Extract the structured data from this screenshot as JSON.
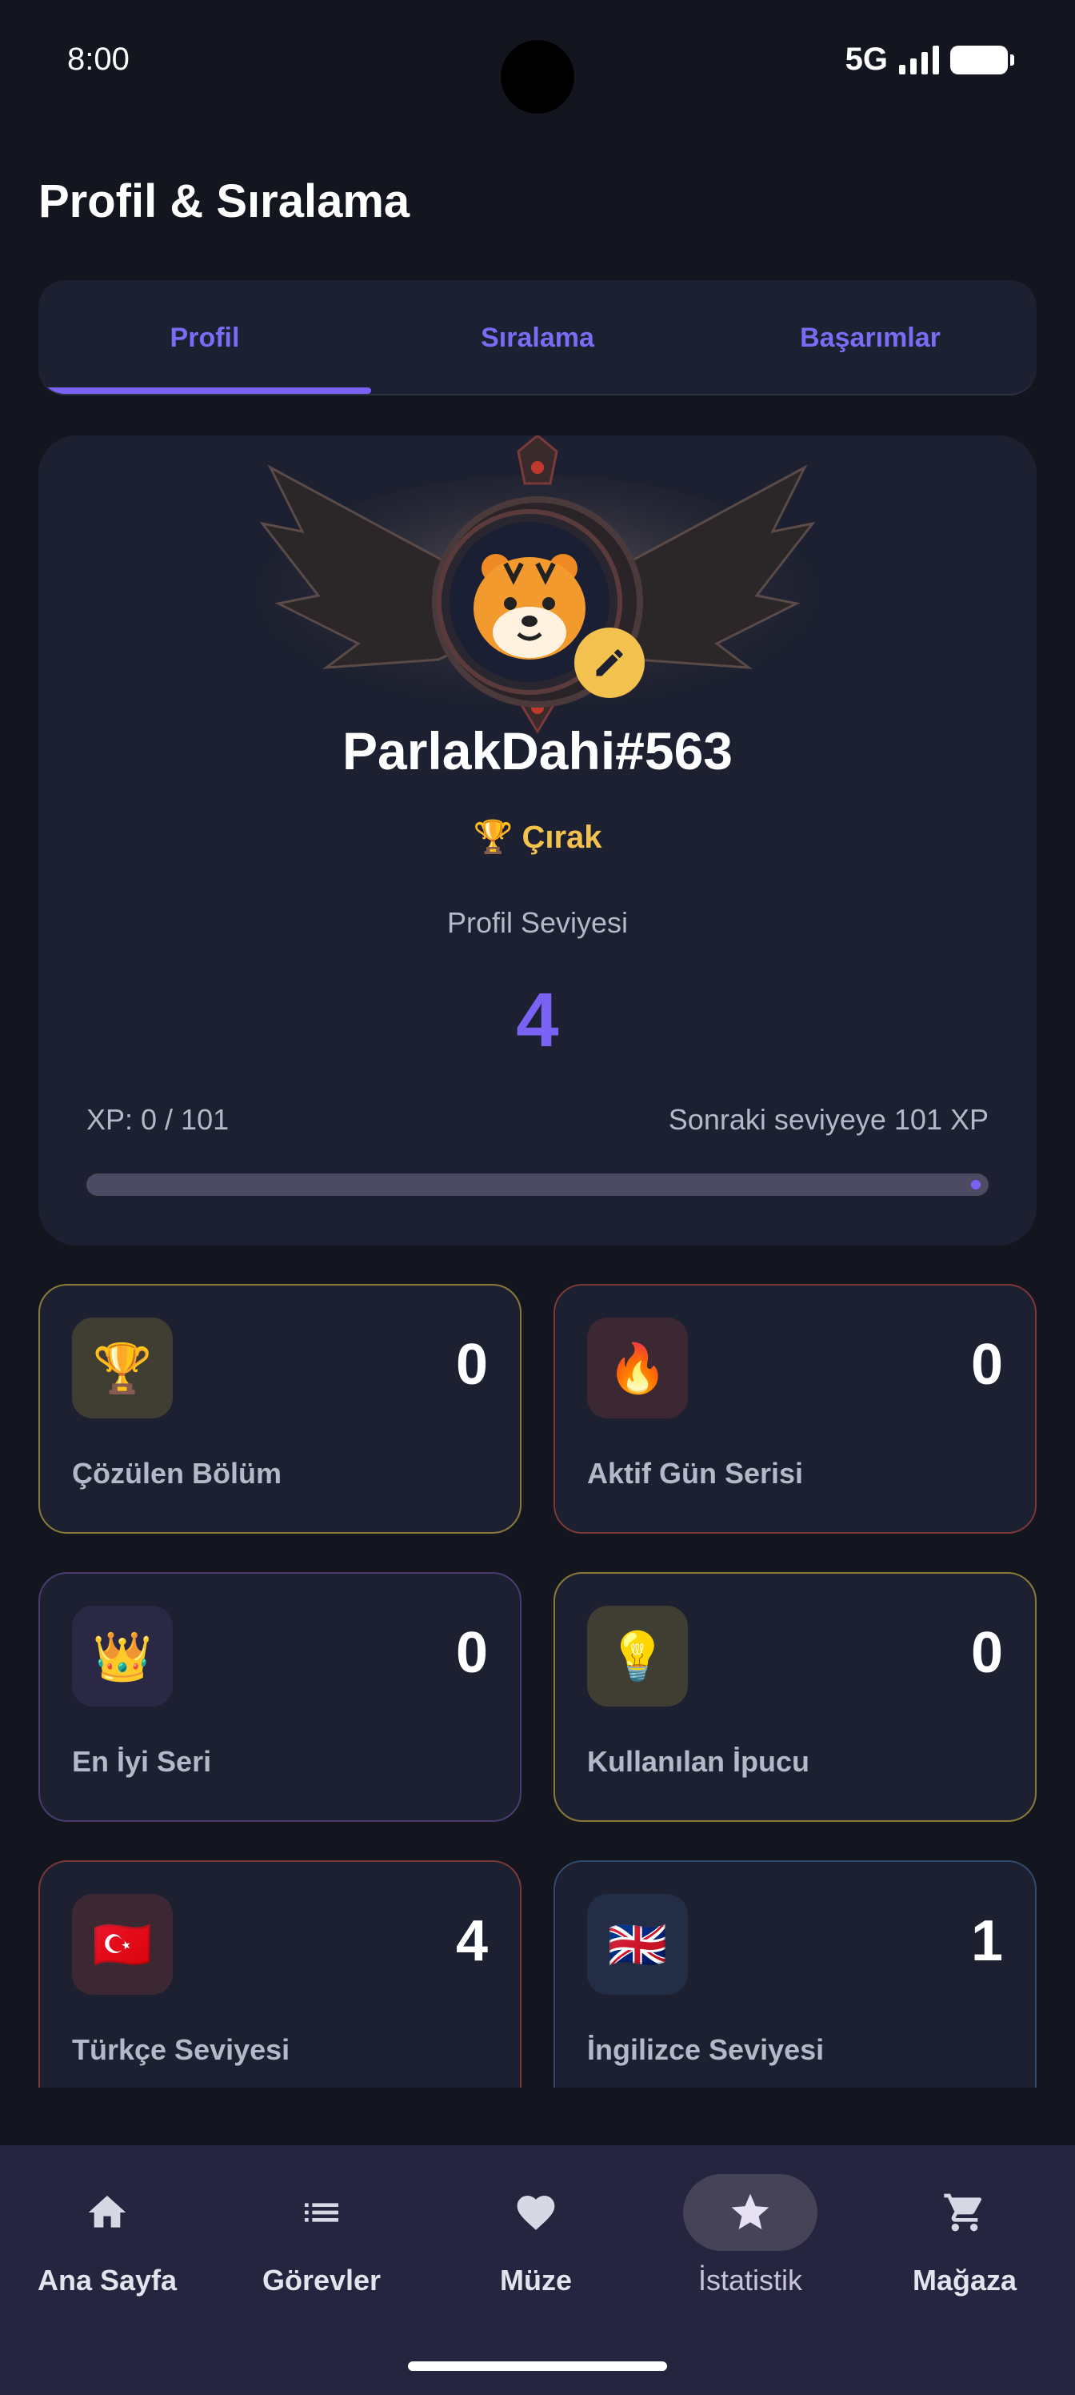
{
  "status_bar": {
    "time": "8:00",
    "network": "5G"
  },
  "page_title": "Profil & Sıralama",
  "tabs": [
    {
      "label": "Profil",
      "active": true
    },
    {
      "label": "Sıralama",
      "active": false
    },
    {
      "label": "Başarımlar",
      "active": false
    }
  ],
  "profile": {
    "avatar_icon": "tiger-icon",
    "username": "ParlakDahi#563",
    "rank_emoji": "🏆",
    "rank": "Çırak",
    "level_caption": "Profil Seviyesi",
    "level": "4",
    "xp_text": "XP: 0 / 101",
    "next_level_text": "Sonraki seviyeye 101 XP",
    "xp_progress": 0
  },
  "stats": [
    {
      "icon": "🏆",
      "value": "0",
      "label": "Çözülen Bölüm",
      "accent": "#8a7a3a"
    },
    {
      "icon": "🔥",
      "value": "0",
      "label": "Aktif Gün Serisi",
      "accent": "#7a3838"
    },
    {
      "icon": "👑",
      "value": "0",
      "label": "En İyi Seri",
      "accent": "#4a3a70"
    },
    {
      "icon": "💡",
      "value": "0",
      "label": "Kullanılan İpucu",
      "accent": "#8a7a3a"
    },
    {
      "icon": "🇹🇷",
      "value": "4",
      "label": "Türkçe Seviyesi",
      "accent": "#7a3838"
    },
    {
      "icon": "🇬🇧",
      "value": "1",
      "label": "İngilizce Seviyesi",
      "accent": "#34496e"
    }
  ],
  "nav": [
    {
      "label": "Ana Sayfa",
      "icon": "home-icon",
      "active": false
    },
    {
      "label": "Görevler",
      "icon": "list-icon",
      "active": false
    },
    {
      "label": "Müze",
      "icon": "heart-icon",
      "active": false
    },
    {
      "label": "İstatistik",
      "icon": "star-icon",
      "active": true
    },
    {
      "label": "Mağaza",
      "icon": "cart-icon",
      "active": false
    }
  ],
  "colors": {
    "accent": "#7a62f4",
    "gold": "#f2c14e",
    "background": "#13151f",
    "card": "#1c2030",
    "nav": "#25253f"
  }
}
